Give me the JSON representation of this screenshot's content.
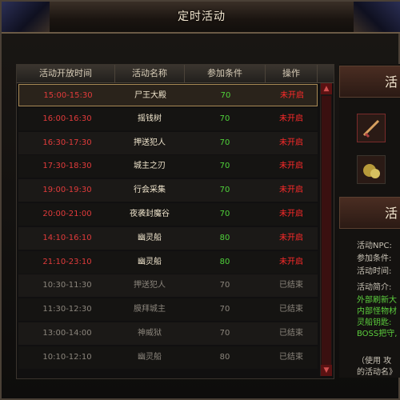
{
  "window": {
    "title": "定时活动"
  },
  "table": {
    "headers": [
      "活动开放时间",
      "活动名称",
      "参加条件",
      "操作"
    ],
    "rows": [
      {
        "time": "15:00-15:30",
        "name": "尸王大殿",
        "level": "70",
        "status": "未开启",
        "active": true
      },
      {
        "time": "16:00-16:30",
        "name": "摇钱树",
        "level": "70",
        "status": "未开启",
        "active": true
      },
      {
        "time": "16:30-17:30",
        "name": "押送犯人",
        "level": "70",
        "status": "未开启",
        "active": true
      },
      {
        "time": "17:30-18:30",
        "name": "城主之刃",
        "level": "70",
        "status": "未开启",
        "active": true
      },
      {
        "time": "19:00-19:30",
        "name": "行会采集",
        "level": "70",
        "status": "未开启",
        "active": true
      },
      {
        "time": "20:00-21:00",
        "name": "夜袭封魔谷",
        "level": "70",
        "status": "未开启",
        "active": true
      },
      {
        "time": "14:10-16:10",
        "name": "幽灵船",
        "level": "80",
        "status": "未开启",
        "active": true
      },
      {
        "time": "21:10-23:10",
        "name": "幽灵船",
        "level": "80",
        "status": "未开启",
        "active": true
      },
      {
        "time": "10:30-11:30",
        "name": "押送犯人",
        "level": "70",
        "status": "已结束",
        "active": false
      },
      {
        "time": "11:30-12:30",
        "name": "膜拜城主",
        "level": "70",
        "status": "已结束",
        "active": false
      },
      {
        "time": "13:00-14:00",
        "name": "神威狱",
        "level": "70",
        "status": "已结束",
        "active": false
      },
      {
        "time": "10:10-12:10",
        "name": "幽灵船",
        "level": "80",
        "status": "已结束",
        "active": false
      }
    ]
  },
  "right_panel": {
    "header1": "活",
    "header2": "活",
    "lines": [
      "活动NPC:",
      "参加条件:",
      "活动时间:",
      "活动简介:",
      "外部刷新大",
      "内部怪物材",
      "灵船钥匙:",
      "BOSS把守,"
    ],
    "footer1": "（使用  攻",
    "footer2": "的活动名》"
  },
  "colors": {
    "active_time": "#e23b3b",
    "name": "#efe4cc",
    "level": "#4fd23a",
    "status_pending": "#ff2a2a",
    "inactive": "#8b857c"
  }
}
